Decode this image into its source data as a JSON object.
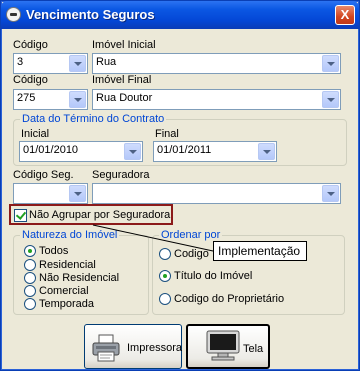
{
  "window": {
    "title": "Vencimento Seguros",
    "close_label": "X"
  },
  "codigo1": {
    "label": "Código",
    "value": "3"
  },
  "imovel_inicial": {
    "label": "Imóvel Inicial",
    "value": "Rua"
  },
  "codigo2": {
    "label": "Código",
    "value": "275"
  },
  "imovel_final": {
    "label": "Imóvel Final",
    "value": "Rua Doutor"
  },
  "contract_end": {
    "legend": "Data do Término do Contrato",
    "start_label": "Inicial",
    "start_value": "01/01/2010",
    "end_label": "Final",
    "end_value": "01/01/2011"
  },
  "cod_seg": {
    "label": "Código Seg.",
    "value": ""
  },
  "seguradora": {
    "label": "Seguradora",
    "value": ""
  },
  "group_checkbox": {
    "label": "Não Agrupar por Seguradora",
    "checked": true
  },
  "natureza": {
    "legend": "Natureza do Imóvel",
    "options": [
      "Todos",
      "Residencial",
      "Não Residencial",
      "Comercial",
      "Temporada"
    ],
    "selected": "Todos"
  },
  "ordenar": {
    "legend": "Ordenar por",
    "options": [
      "Codigo",
      "Título do Imóvel",
      "Codigo do Proprietário"
    ],
    "selected": "Título do Imóvel"
  },
  "tooltip": {
    "text": "Implementação"
  },
  "buttons": {
    "print_label": "Impressora",
    "screen_label": "Tela"
  },
  "colors": {
    "title_bar": "#0447d6",
    "group_legend": "#0046d5",
    "highlight": "#8b1a1a",
    "radio_dot": "#21a121"
  }
}
